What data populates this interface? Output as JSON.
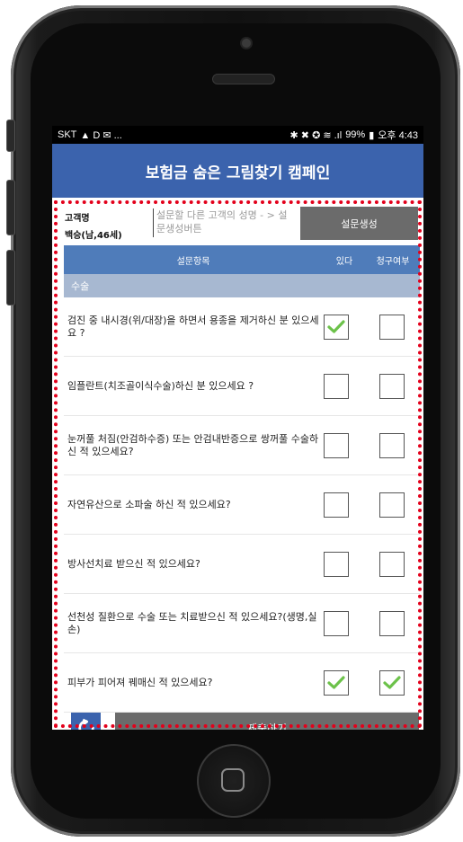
{
  "statusbar": {
    "carrier": "SKT",
    "left_icons": "▲ D ✉ ...",
    "right_icons": "✱ ✖ ✪ ≋ .ıl",
    "battery": "99%",
    "battery_icon": "▮",
    "time": "오후 4:43"
  },
  "appbar": {
    "title": "보험금 숨은 그림찾기 캠페인"
  },
  "customer": {
    "label": "고객명",
    "name": "백승(남,46세)",
    "input_placeholder": "설문할 다른 고객의 성명 - > 설문생성버튼",
    "generate_button": "설문생성"
  },
  "table": {
    "headers": {
      "item": "설문항목",
      "yes": "있다",
      "claim": "청구여부"
    },
    "category": "수술",
    "rows": [
      {
        "text": "검진 중 내시경(위/대장)을 하면서 용종을 제거하신 분 있으세요 ?",
        "yes": true,
        "claim": false
      },
      {
        "text": "임플란트(치조골이식수술)하신 분 있으세요 ?",
        "yes": false,
        "claim": false
      },
      {
        "text": "눈꺼풀 처짐(안검하수증) 또는 안검내반증으로 쌍꺼풀 수술하신 적 있으세요?",
        "yes": false,
        "claim": false
      },
      {
        "text": "자연유산으로 소파술 하신 적 있으세요?",
        "yes": false,
        "claim": false
      },
      {
        "text": "방사선치료 받으신 적 있으세요?",
        "yes": false,
        "claim": false
      },
      {
        "text": "선천성 질환으로 수술 또는 치료받으신 적 있으세요?(생명,실손)",
        "yes": false,
        "claim": false
      },
      {
        "text": "피부가 피어져 꿰매신 적 있으세요?",
        "yes": true,
        "claim": true
      }
    ]
  },
  "footer": {
    "refresh_icon": "refresh-icon",
    "submit": "제출하기"
  },
  "colors": {
    "appbar": "#3b63ad",
    "table_header": "#4f7cba",
    "category": "#a7b8d1",
    "button_gray": "#6b6b6b",
    "dotted_border": "#e3001b",
    "check": "#6cc24a"
  }
}
